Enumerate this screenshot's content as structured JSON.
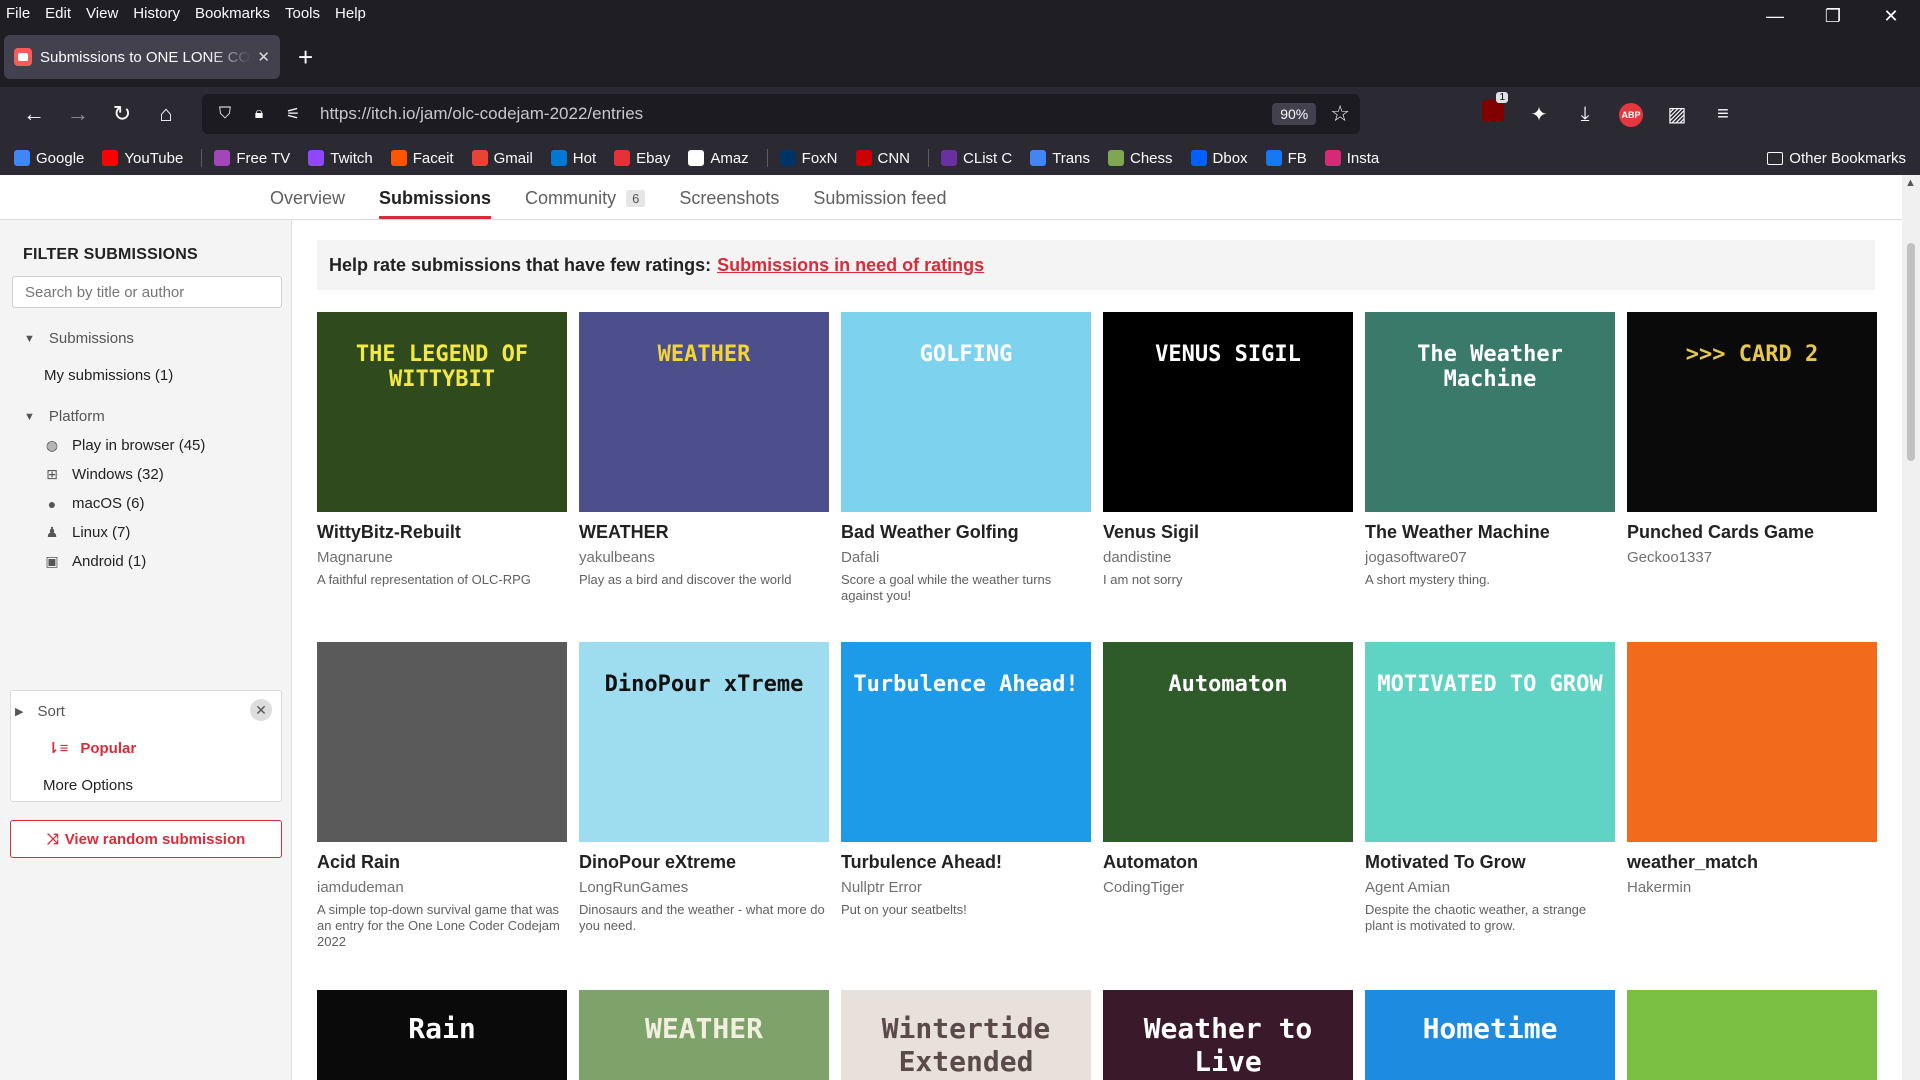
{
  "browser": {
    "menu": [
      "File",
      "Edit",
      "View",
      "History",
      "Bookmarks",
      "Tools",
      "Help"
    ],
    "tab_title": "Submissions to ONE LONE CODER",
    "url": "https://itch.io/jam/olc-codejam-2022/entries",
    "zoom": "90%",
    "ublock_badge": "1",
    "abp_label": "ABP",
    "bookmarks": [
      {
        "label": "Google",
        "icon": "google-icon",
        "color": "#4285f4"
      },
      {
        "label": "YouTube",
        "icon": "youtube-icon",
        "color": "#ff0000"
      },
      {
        "label": "Free TV",
        "icon": "tv-icon",
        "color": "#a246b8"
      },
      {
        "label": "Twitch",
        "icon": "twitch-icon",
        "color": "#9146ff"
      },
      {
        "label": "Faceit",
        "icon": "faceit-icon",
        "color": "#ff5500"
      },
      {
        "label": "Gmail",
        "icon": "gmail-icon",
        "color": "#ea4335"
      },
      {
        "label": "Hot",
        "icon": "hotmail-icon",
        "color": "#0078d4"
      },
      {
        "label": "Ebay",
        "icon": "ebay-icon",
        "color": "#e53238"
      },
      {
        "label": "Amaz",
        "icon": "amazon-icon",
        "color": "#ffffff"
      },
      {
        "label": "FoxN",
        "icon": "foxnews-icon",
        "color": "#003366"
      },
      {
        "label": "CNN",
        "icon": "cnn-icon",
        "color": "#cc0000"
      },
      {
        "label": "CList C",
        "icon": "clist-icon",
        "color": "#6a2fa0"
      },
      {
        "label": "Trans",
        "icon": "translate-icon",
        "color": "#4285f4"
      },
      {
        "label": "Chess",
        "icon": "chess-icon",
        "color": "#7fa650"
      },
      {
        "label": "Dbox",
        "icon": "dropbox-icon",
        "color": "#0061ff"
      },
      {
        "label": "FB",
        "icon": "facebook-icon",
        "color": "#1877f2"
      },
      {
        "label": "Insta",
        "icon": "instagram-icon",
        "color": "#d62976"
      }
    ],
    "other_bookmarks": "Other Bookmarks"
  },
  "jam_nav": {
    "overview": "Overview",
    "submissions": "Submissions",
    "community": "Community",
    "community_count": "6",
    "screenshots": "Screenshots",
    "feed": "Submission feed"
  },
  "sidebar": {
    "title": "FILTER SUBMISSIONS",
    "search_placeholder": "Search by title or author",
    "submissions_group": "Submissions",
    "my_submissions": "My submissions (1)",
    "platform_group": "Platform",
    "platforms": [
      {
        "label": "Play in browser (45)",
        "icon": "globe-icon",
        "glyph": "◍"
      },
      {
        "label": "Windows (32)",
        "icon": "windows-icon",
        "glyph": "⊞"
      },
      {
        "label": "macOS (6)",
        "icon": "apple-icon",
        "glyph": "●"
      },
      {
        "label": "Linux (7)",
        "icon": "linux-icon",
        "glyph": "♟"
      },
      {
        "label": "Android (1)",
        "icon": "android-icon",
        "glyph": "▣"
      }
    ],
    "sort_group": "Sort",
    "sort_value": "Popular",
    "more_options": "More Options",
    "random_button": "View random submission"
  },
  "main": {
    "rate_text": "Help rate submissions that have few ratings:",
    "rate_link": "Submissions in need of ratings"
  },
  "games": [
    {
      "title": "WittyBitz-Rebuilt",
      "author": "Magnarune",
      "desc": "A faithful representation of OLC-RPG",
      "thumb": "THE LEGEND OF WITTYBIT",
      "bg": "#2f4a1c",
      "fg": "#f4e842"
    },
    {
      "title": "WEATHER",
      "author": "yakulbeans",
      "desc": "Play as a bird and discover the world",
      "thumb": "WEATHER",
      "bg": "#4d4f8c",
      "fg": "#f2d43a"
    },
    {
      "title": "Bad Weather Golfing",
      "author": "Dafali",
      "desc": "Score a goal while the weather turns against you!",
      "thumb": "GOLFING",
      "bg": "#7dd3ee",
      "fg": "#ffffff"
    },
    {
      "title": "Venus Sigil",
      "author": "dandistine",
      "desc": "I am not sorry",
      "thumb": "VENUS SIGIL",
      "bg": "#000000",
      "fg": "#ffffff"
    },
    {
      "title": "The Weather Machine",
      "author": "jogasoftware07",
      "desc": "A short mystery thing.",
      "thumb": "The Weather Machine",
      "bg": "#3a7a6a",
      "fg": "#ffffff"
    },
    {
      "title": "Punched Cards Game",
      "author": "Geckoo1337",
      "desc": "",
      "thumb": ">>> CARD 2",
      "bg": "#0a0a0a",
      "fg": "#e6c84a"
    },
    {
      "title": "Acid Rain",
      "author": "iamdudeman",
      "desc": "A simple top-down survival game that was an entry for the One Lone Coder Codejam 2022",
      "thumb": "",
      "bg": "#5a5a5a",
      "fg": "#ffffff"
    },
    {
      "title": "DinoPour eXtreme",
      "author": "LongRunGames",
      "desc": "Dinosaurs and the weather - what more do you need.",
      "thumb": "DinoPour xTreme",
      "bg": "#9edcf0",
      "fg": "#111111"
    },
    {
      "title": "Turbulence Ahead!",
      "author": "Nullptr Error",
      "desc": "Put on your seatbelts!",
      "thumb": "Turbulence Ahead!",
      "bg": "#1e9be8",
      "fg": "#ffffff"
    },
    {
      "title": "Automaton",
      "author": "CodingTiger",
      "desc": "",
      "thumb": "Automaton",
      "bg": "#2f5a2a",
      "fg": "#ffffff"
    },
    {
      "title": "Motivated To Grow",
      "author": "Agent Amian",
      "desc": "Despite the chaotic weather, a strange plant is motivated to grow.",
      "thumb": "MOTIVATED TO GROW",
      "bg": "#5fd4c4",
      "fg": "#ffffff"
    },
    {
      "title": "weather_match",
      "author": "Hakermin",
      "desc": "",
      "thumb": "",
      "bg": "#f26a1b",
      "fg": "#ffffff"
    }
  ],
  "row3": [
    {
      "thumb": "Rain",
      "bg": "#0a0a0a",
      "fg": "#ffffff"
    },
    {
      "thumb": "WEATHER",
      "bg": "#7ea36a",
      "fg": "#f2efe0"
    },
    {
      "thumb": "Wintertide Extended",
      "bg": "#e8e0da",
      "fg": "#5a4a4a"
    },
    {
      "thumb": "Weather to Live",
      "bg": "#3a1a2a",
      "fg": "#ffffff"
    },
    {
      "thumb": "Hometime",
      "bg": "#1d8ce0",
      "fg": "#ffffff"
    },
    {
      "thumb": "",
      "bg": "#7bc043",
      "fg": "#ffffff"
    }
  ]
}
